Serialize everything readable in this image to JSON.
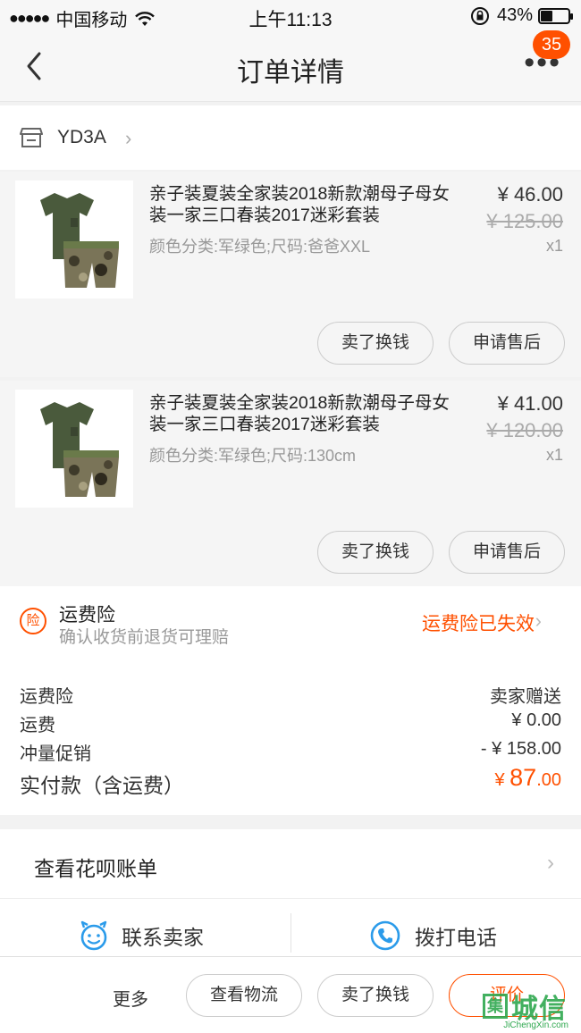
{
  "status_bar": {
    "carrier": "中国移动",
    "time": "上午11:13",
    "battery": "43%",
    "battery_level": 0.43
  },
  "nav": {
    "title": "订单详情",
    "badge_count": "35",
    "more_glyph": "•••"
  },
  "shop": {
    "name": "YD3A",
    "arrow": "›"
  },
  "items": [
    {
      "title": "亲子装夏装全家装2018新款潮母子母女装一家三口春装2017迷彩套装",
      "sku": "颜色分类:军绿色;尺码:爸爸XXL",
      "price": "¥ 46.00",
      "original_price": "¥ 125.00",
      "qty": "x1",
      "btn_sell": "卖了换钱",
      "btn_aftersale": "申请售后"
    },
    {
      "title": "亲子装夏装全家装2018新款潮母子母女装一家三口春装2017迷彩套装",
      "sku": "颜色分类:军绿色;尺码:130cm",
      "price": "¥ 41.00",
      "original_price": "¥ 120.00",
      "qty": "x1",
      "btn_sell": "卖了换钱",
      "btn_aftersale": "申请售后"
    }
  ],
  "insurance": {
    "icon_text": "险",
    "title": "运费险",
    "subtitle": "确认收货前退货可理赔",
    "status": "运费险已失效",
    "arrow": "›"
  },
  "totals": {
    "rows": [
      {
        "label": "运费险",
        "value": "卖家赠送"
      },
      {
        "label": "运费",
        "value": "¥ 0.00"
      },
      {
        "label": "冲量促销",
        "value": "- ¥ 158.00"
      }
    ],
    "pay_label": "实付款（含运费）",
    "pay_currency": "¥ ",
    "pay_integer": "87",
    "pay_decimal": ".00"
  },
  "huabei": {
    "label": "查看花呗账单",
    "arrow": "›"
  },
  "contact": {
    "seller": "联系卖家",
    "phone": "拨打电话"
  },
  "bottom_bar": {
    "more": "更多",
    "logistics": "查看物流",
    "sell": "卖了换钱",
    "review": "评价"
  },
  "watermark": {
    "box_char": "集",
    "text": "城信",
    "url": "JiChengXin.com"
  },
  "colors": {
    "accent": "#ff5000",
    "contact_blue": "#2b9bea",
    "watermark_green": "#2fa84f"
  }
}
